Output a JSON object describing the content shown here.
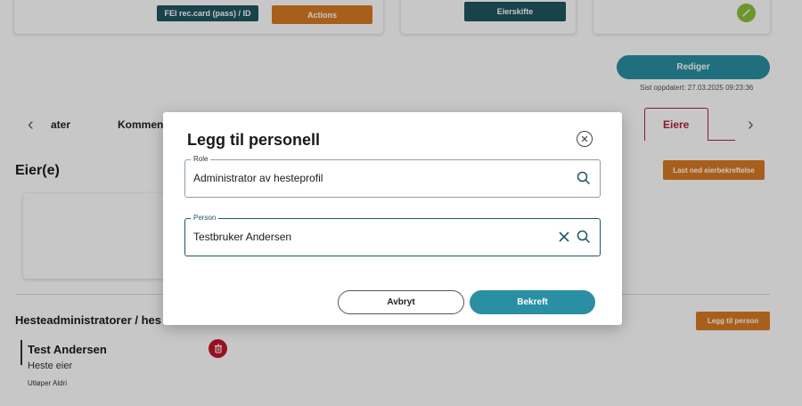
{
  "top_cards": {
    "fei_button": "FEI rec.card (pass) / ID",
    "actions_button": "Actions",
    "owner_change_button": "Eierskifte"
  },
  "header": {
    "edit_button": "Rediger",
    "last_updated": "Sist oppdatert: 27.03.2025 09:23:36"
  },
  "tabs": {
    "items": [
      "ater",
      "Kommen",
      "Eiere"
    ],
    "active": "Eiere"
  },
  "owners_section": {
    "title": "Eier(e)",
    "download_button": "Last ned eierbekreftelse"
  },
  "admins_section": {
    "title": "Hesteadministratorer / hes",
    "add_button": "Legg til person",
    "person": {
      "name": "Test Andersen",
      "role": "Heste eier",
      "expiry": "Utløper Aldri"
    }
  },
  "modal": {
    "title": "Legg til personell",
    "role_field": {
      "label": "Role",
      "value": "Administrator av hesteprofil"
    },
    "person_field": {
      "label": "Person",
      "value": "Testbruker Andersen"
    },
    "cancel_button": "Avbryt",
    "confirm_button": "Bekreft"
  },
  "colors": {
    "teal": "#2a8fa3",
    "dark_teal": "#1f5661",
    "orange": "#d97a24",
    "active_tab": "#b0203a"
  },
  "icons": [
    "edit-icon",
    "chevron-left-icon",
    "chevron-right-icon",
    "trash-icon",
    "close-icon",
    "search-icon",
    "clear-icon"
  ]
}
